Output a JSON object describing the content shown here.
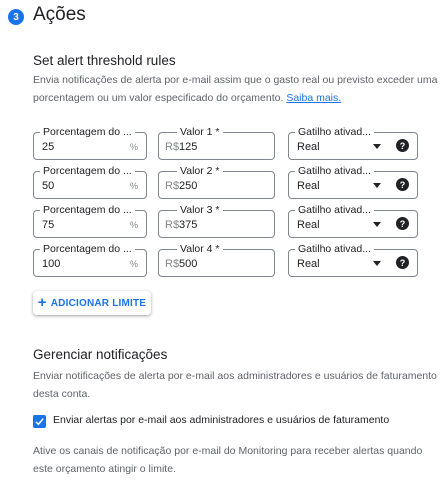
{
  "section": {
    "step_number": "3",
    "title": "Ações"
  },
  "threshold": {
    "title": "Set alert threshold rules",
    "description": "Envia notificações de alerta por e-mail assim que o gasto real ou previsto exceder uma porcentagem ou um valor especificado do orçamento.",
    "learn_more": "Saiba mais.",
    "rules": [
      {
        "pct_label": "Porcentagem do ...",
        "pct_value": "25",
        "pct_suffix": "%",
        "amount_label": "Valor 1 *",
        "currency": "R$",
        "amount_value": "125",
        "trigger_label": "Gatilho ativad...",
        "trigger_value": "Real"
      },
      {
        "pct_label": "Porcentagem do ...",
        "pct_value": "50",
        "pct_suffix": "%",
        "amount_label": "Valor 2 *",
        "currency": "R$",
        "amount_value": "250",
        "trigger_label": "Gatilho ativad...",
        "trigger_value": "Real"
      },
      {
        "pct_label": "Porcentagem do ...",
        "pct_value": "75",
        "pct_suffix": "%",
        "amount_label": "Valor 3 *",
        "currency": "R$",
        "amount_value": "375",
        "trigger_label": "Gatilho ativad...",
        "trigger_value": "Real"
      },
      {
        "pct_label": "Porcentagem do ...",
        "pct_value": "100",
        "pct_suffix": "%",
        "amount_label": "Valor 4 *",
        "currency": "R$",
        "amount_value": "500",
        "trigger_label": "Gatilho ativad...",
        "trigger_value": "Real"
      }
    ],
    "add_button": {
      "icon": "+",
      "label": "ADICIONAR LIMITE"
    }
  },
  "notifications": {
    "title": "Gerenciar notificações",
    "description": "Enviar notificações de alerta por e-mail aos administradores e usuários de faturamento desta conta.",
    "checkbox_label": "Enviar alertas por e-mail aos administradores e usuários de faturamento",
    "checkbox_checked": true,
    "monitoring_text": "Ative os canais de notificação por e-mail do Monitoring para receber alertas quando este orçamento atingir o limite."
  },
  "colors": {
    "accent": "#1a73e8",
    "text": "#202124",
    "muted": "#5f6368",
    "border": "#80868b"
  }
}
